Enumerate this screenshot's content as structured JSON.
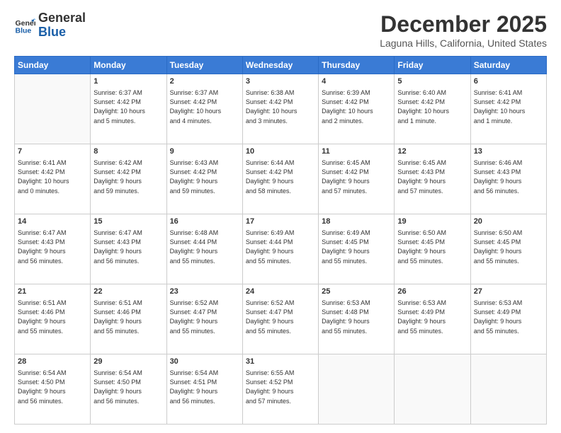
{
  "header": {
    "logo_line1": "General",
    "logo_line2": "Blue",
    "month_title": "December 2025",
    "location": "Laguna Hills, California, United States"
  },
  "days": [
    "Sunday",
    "Monday",
    "Tuesday",
    "Wednesday",
    "Thursday",
    "Friday",
    "Saturday"
  ],
  "weeks": [
    [
      {
        "date": "",
        "info": ""
      },
      {
        "date": "1",
        "info": "Sunrise: 6:37 AM\nSunset: 4:42 PM\nDaylight: 10 hours\nand 5 minutes."
      },
      {
        "date": "2",
        "info": "Sunrise: 6:37 AM\nSunset: 4:42 PM\nDaylight: 10 hours\nand 4 minutes."
      },
      {
        "date": "3",
        "info": "Sunrise: 6:38 AM\nSunset: 4:42 PM\nDaylight: 10 hours\nand 3 minutes."
      },
      {
        "date": "4",
        "info": "Sunrise: 6:39 AM\nSunset: 4:42 PM\nDaylight: 10 hours\nand 2 minutes."
      },
      {
        "date": "5",
        "info": "Sunrise: 6:40 AM\nSunset: 4:42 PM\nDaylight: 10 hours\nand 1 minute."
      },
      {
        "date": "6",
        "info": "Sunrise: 6:41 AM\nSunset: 4:42 PM\nDaylight: 10 hours\nand 1 minute."
      }
    ],
    [
      {
        "date": "7",
        "info": "Sunrise: 6:41 AM\nSunset: 4:42 PM\nDaylight: 10 hours\nand 0 minutes."
      },
      {
        "date": "8",
        "info": "Sunrise: 6:42 AM\nSunset: 4:42 PM\nDaylight: 9 hours\nand 59 minutes."
      },
      {
        "date": "9",
        "info": "Sunrise: 6:43 AM\nSunset: 4:42 PM\nDaylight: 9 hours\nand 59 minutes."
      },
      {
        "date": "10",
        "info": "Sunrise: 6:44 AM\nSunset: 4:42 PM\nDaylight: 9 hours\nand 58 minutes."
      },
      {
        "date": "11",
        "info": "Sunrise: 6:45 AM\nSunset: 4:42 PM\nDaylight: 9 hours\nand 57 minutes."
      },
      {
        "date": "12",
        "info": "Sunrise: 6:45 AM\nSunset: 4:43 PM\nDaylight: 9 hours\nand 57 minutes."
      },
      {
        "date": "13",
        "info": "Sunrise: 6:46 AM\nSunset: 4:43 PM\nDaylight: 9 hours\nand 56 minutes."
      }
    ],
    [
      {
        "date": "14",
        "info": "Sunrise: 6:47 AM\nSunset: 4:43 PM\nDaylight: 9 hours\nand 56 minutes."
      },
      {
        "date": "15",
        "info": "Sunrise: 6:47 AM\nSunset: 4:43 PM\nDaylight: 9 hours\nand 56 minutes."
      },
      {
        "date": "16",
        "info": "Sunrise: 6:48 AM\nSunset: 4:44 PM\nDaylight: 9 hours\nand 55 minutes."
      },
      {
        "date": "17",
        "info": "Sunrise: 6:49 AM\nSunset: 4:44 PM\nDaylight: 9 hours\nand 55 minutes."
      },
      {
        "date": "18",
        "info": "Sunrise: 6:49 AM\nSunset: 4:45 PM\nDaylight: 9 hours\nand 55 minutes."
      },
      {
        "date": "19",
        "info": "Sunrise: 6:50 AM\nSunset: 4:45 PM\nDaylight: 9 hours\nand 55 minutes."
      },
      {
        "date": "20",
        "info": "Sunrise: 6:50 AM\nSunset: 4:45 PM\nDaylight: 9 hours\nand 55 minutes."
      }
    ],
    [
      {
        "date": "21",
        "info": "Sunrise: 6:51 AM\nSunset: 4:46 PM\nDaylight: 9 hours\nand 55 minutes."
      },
      {
        "date": "22",
        "info": "Sunrise: 6:51 AM\nSunset: 4:46 PM\nDaylight: 9 hours\nand 55 minutes."
      },
      {
        "date": "23",
        "info": "Sunrise: 6:52 AM\nSunset: 4:47 PM\nDaylight: 9 hours\nand 55 minutes."
      },
      {
        "date": "24",
        "info": "Sunrise: 6:52 AM\nSunset: 4:47 PM\nDaylight: 9 hours\nand 55 minutes."
      },
      {
        "date": "25",
        "info": "Sunrise: 6:53 AM\nSunset: 4:48 PM\nDaylight: 9 hours\nand 55 minutes."
      },
      {
        "date": "26",
        "info": "Sunrise: 6:53 AM\nSunset: 4:49 PM\nDaylight: 9 hours\nand 55 minutes."
      },
      {
        "date": "27",
        "info": "Sunrise: 6:53 AM\nSunset: 4:49 PM\nDaylight: 9 hours\nand 55 minutes."
      }
    ],
    [
      {
        "date": "28",
        "info": "Sunrise: 6:54 AM\nSunset: 4:50 PM\nDaylight: 9 hours\nand 56 minutes."
      },
      {
        "date": "29",
        "info": "Sunrise: 6:54 AM\nSunset: 4:50 PM\nDaylight: 9 hours\nand 56 minutes."
      },
      {
        "date": "30",
        "info": "Sunrise: 6:54 AM\nSunset: 4:51 PM\nDaylight: 9 hours\nand 56 minutes."
      },
      {
        "date": "31",
        "info": "Sunrise: 6:55 AM\nSunset: 4:52 PM\nDaylight: 9 hours\nand 57 minutes."
      },
      {
        "date": "",
        "info": ""
      },
      {
        "date": "",
        "info": ""
      },
      {
        "date": "",
        "info": ""
      }
    ]
  ]
}
